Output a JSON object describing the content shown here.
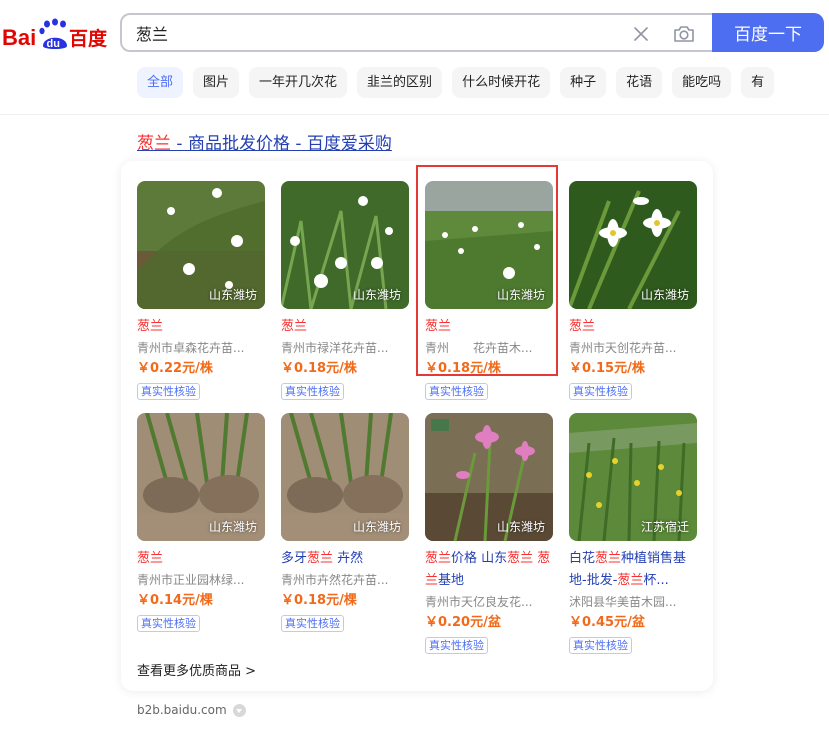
{
  "logo": {
    "text_bai": "Bai",
    "text_du": "du",
    "text_cn": "百度"
  },
  "search": {
    "value": "葱兰",
    "button": "百度一下"
  },
  "tags": [
    "全部",
    "图片",
    "一年开几次花",
    "韭兰的区别",
    "什么时候开花",
    "种子",
    "花语",
    "能吃吗",
    "有"
  ],
  "result": {
    "title_hl": "葱兰",
    "title_rest": " - 商品批发价格 - 百度爱采购",
    "verify_label": "真实性核验",
    "items": [
      {
        "name": "葱兰",
        "seller": "青州市卓森花卉苗...",
        "price": "￥0.22元/株",
        "loc": "山东潍坊"
      },
      {
        "name": "葱兰",
        "seller": "青州市禄洋花卉苗...",
        "price": "￥0.18元/株",
        "loc": "山东潍坊"
      },
      {
        "name": "葱兰",
        "seller": "青州　　花卉苗木...",
        "price": "￥0.18元/株",
        "loc": "山东潍坊"
      },
      {
        "name": "葱兰",
        "seller": "青州市天创花卉苗...",
        "price": "￥0.15元/株",
        "loc": "山东潍坊"
      },
      {
        "name": "葱兰",
        "seller": "青州市正业园林绿...",
        "price": "￥0.14元/棵",
        "loc": "山东潍坊"
      },
      {
        "name_a": "多牙",
        "name_hl": "葱兰",
        "name_b": " 卉然",
        "seller": "青州市卉然花卉苗...",
        "price": "￥0.18元/棵",
        "loc": "山东潍坊"
      },
      {
        "name_p1": "葱兰",
        "name_p2": "价格 山东",
        "name_p3": "葱兰",
        "name_p4": " 葱",
        "name_p5": "兰",
        "name_p6": "基地",
        "seller": "青州市天亿良友花...",
        "price": "￥0.20元/盆",
        "loc": "山东潍坊"
      },
      {
        "name_p1": "白花",
        "name_p2": "葱兰",
        "name_p3": "种植销售基地-批发-",
        "name_p4": "葱兰",
        "name_p5": "杯...",
        "seller": "沭阳县华美苗木园...",
        "price": "￥0.45元/盆",
        "loc": "江苏宿迁"
      }
    ],
    "more": "查看更多优质商品 >",
    "domain": "b2b.baidu.com"
  }
}
